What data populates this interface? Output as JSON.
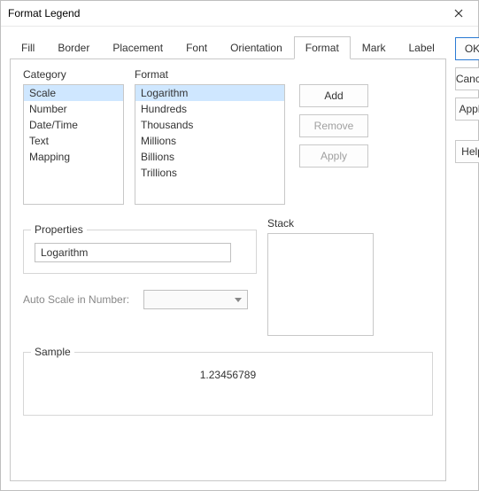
{
  "window": {
    "title": "Format Legend"
  },
  "tabs": [
    "Fill",
    "Border",
    "Placement",
    "Font",
    "Orientation",
    "Format",
    "Mark",
    "Label"
  ],
  "active_tab": "Format",
  "labels": {
    "category": "Category",
    "format": "Format",
    "stack": "Stack",
    "properties": "Properties",
    "auto_scale": "Auto Scale in Number:",
    "sample": "Sample"
  },
  "category_items": [
    "Scale",
    "Number",
    "Date/Time",
    "Text",
    "Mapping"
  ],
  "category_selected": "Scale",
  "format_items": [
    "Logarithm",
    "Hundreds",
    "Thousands",
    "Millions",
    "Billions",
    "Trillions"
  ],
  "format_selected": "Logarithm",
  "list_buttons": {
    "add": "Add",
    "remove": "Remove",
    "apply": "Apply"
  },
  "properties_value": "Logarithm",
  "sample_value": "1.23456789",
  "side_buttons": {
    "ok": "OK",
    "cancel": "Cancel",
    "apply": "Apply",
    "help": "Help"
  }
}
